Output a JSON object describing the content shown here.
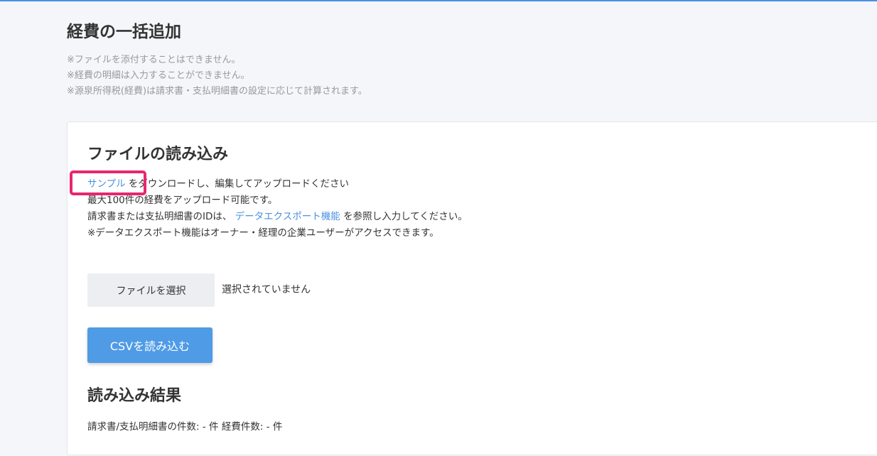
{
  "page": {
    "title": "経費の一括追加",
    "notes": [
      "※ファイルを添付することはできません。",
      "※経費の明細は入力することができません。",
      "※源泉所得税(経費)は請求書・支払明細書の設定に応じて計算されます。"
    ]
  },
  "upload": {
    "title": "ファイルの読み込み",
    "sample_link": "サンプル",
    "line1_rest": " をダウンロードし、編集してアップロードください",
    "line2": "最大100件の経費をアップロード可能です。",
    "line3_prefix": "請求書または支払明細書のIDは、 ",
    "export_link": "データエクスポート機能",
    "line3_suffix": " を参照し入力してください。",
    "line4": "※データエクスポート機能はオーナー・経理の企業ユーザーがアクセスできます。",
    "file_button_label": "ファイルを選択",
    "file_status": "選択されていません",
    "csv_button_label": "CSVを読み込む"
  },
  "result": {
    "title": "読み込み結果",
    "counts": "請求書/支払明細書の件数: - 件 経費件数: - 件"
  },
  "colors": {
    "accent": "#4a90e2",
    "highlight": "#e8266f",
    "primary_button": "#4f9be6"
  }
}
